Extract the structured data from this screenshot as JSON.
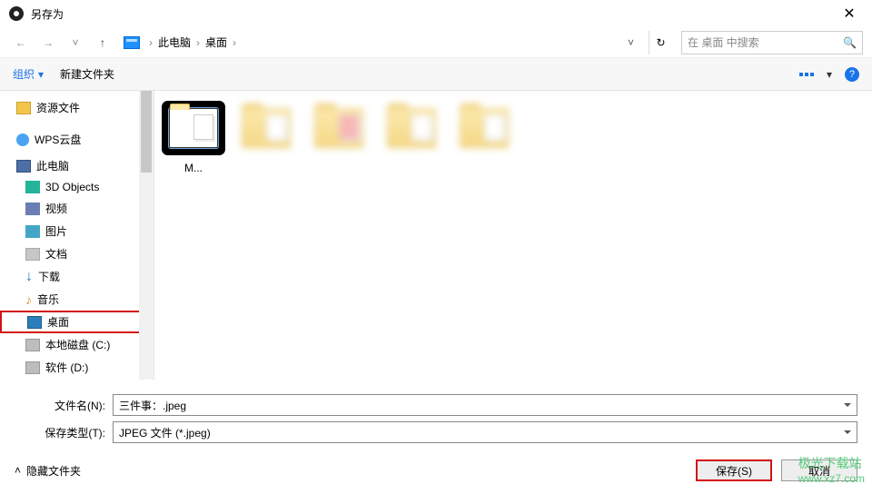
{
  "window": {
    "title": "另存为"
  },
  "nav": {
    "crumb0": "此电脑",
    "crumb1": "桌面",
    "search_placeholder": "在 桌面 中搜索"
  },
  "toolbar": {
    "organize": "组织",
    "newfolder": "新建文件夹"
  },
  "tree": {
    "resources": "资源文件",
    "wps": "WPS云盘",
    "thispc": "此电脑",
    "objects3d": "3D Objects",
    "videos": "视频",
    "pictures": "图片",
    "documents": "文档",
    "downloads": "下载",
    "music": "音乐",
    "desktop": "桌面",
    "diskc": "本地磁盘 (C:)",
    "diskd": "软件 (D:)"
  },
  "files": {
    "item0": "M..."
  },
  "bottom": {
    "filename_label": "文件名(N):",
    "filename_value": "三件事：.jpeg",
    "type_label": "保存类型(T):",
    "type_value": "JPEG 文件 (*.jpeg)"
  },
  "footer": {
    "hide": "隐藏文件夹",
    "save": "保存(S)",
    "cancel": "取消"
  },
  "watermark": {
    "l1": "极光下载站",
    "l2": "www.xz7.com"
  }
}
